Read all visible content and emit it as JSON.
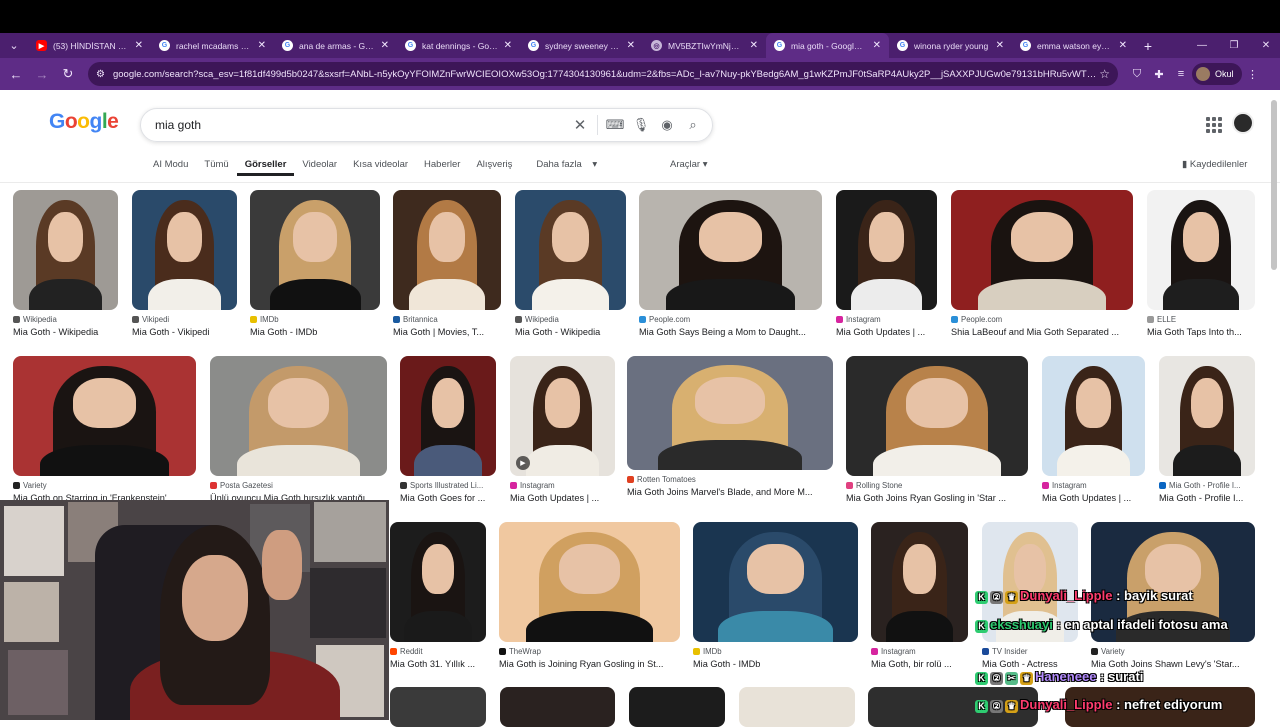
{
  "browser": {
    "tabs": [
      {
        "title": "(53) HİNDİSTAN YOL",
        "favicon": "youtube-icon",
        "active": false
      },
      {
        "title": "rachel mcadams - Go",
        "favicon": "google-icon",
        "active": false
      },
      {
        "title": "ana de armas - Goog",
        "favicon": "google-icon",
        "active": false
      },
      {
        "title": "kat dennings - Goog",
        "favicon": "google-icon",
        "active": false
      },
      {
        "title": "sydney sweeney - Go",
        "favicon": "google-icon",
        "active": false
      },
      {
        "title": "MV5BZTIwYmNjMjc",
        "favicon": "globe-icon",
        "active": false
      },
      {
        "title": "mia goth - Google'da",
        "favicon": "google-icon",
        "active": true
      },
      {
        "title": "winona ryder young",
        "favicon": "google-icon",
        "active": false
      },
      {
        "title": "emma watson eyes -",
        "favicon": "google-icon",
        "active": false
      }
    ],
    "url": "google.com/search?sca_esv=1f81df499d5b0247&sxsrf=ANbL-n5ykOyYFOIMZnFwrWCIEOIOXw53Og:1774304130961&udm=2&fbs=ADc_l-av7Nuy-pkYBedg6AM_g1wKZPmJF0tSaRP4AUky2P__jSAXXPJUGw0e79131bHRu5vWTbF2aoFlcU...",
    "profile_label": "Okul"
  },
  "google": {
    "logo": "Google",
    "query": "mia goth",
    "filters": [
      "AI Modu",
      "Tümü",
      "Görseller",
      "Videolar",
      "Kısa videolar",
      "Haberler",
      "Alışveriş",
      "Daha fazla"
    ],
    "active_filter": "Görseller",
    "tools_label": "Araçlar",
    "saved_label": "Kaydedilenler"
  },
  "results": [
    {
      "source": "Wikipedia",
      "title": "Mia Goth - Wikipedia"
    },
    {
      "source": "Vikipedi",
      "title": "Mia Goth - Vikipedi"
    },
    {
      "source": "IMDb",
      "title": "Mia Goth - IMDb"
    },
    {
      "source": "Britannica",
      "title": "Mia Goth | Movies, T..."
    },
    {
      "source": "Wikipedia",
      "title": "Mia Goth - Wikipedia"
    },
    {
      "source": "People.com",
      "title": "Mia Goth Says Being a Mom to Daught..."
    },
    {
      "source": "Instagram",
      "title": "Mia Goth Updates | ..."
    },
    {
      "source": "People.com",
      "title": "Shia LaBeouf and Mia Goth Separated ..."
    },
    {
      "source": "ELLE",
      "title": "Mia Goth Taps Into th..."
    },
    {
      "source": "Variety",
      "title": "Mia Goth on Starring in 'Frankenstein'"
    },
    {
      "source": "Posta Gazetesi",
      "title": "Ünlü oyuncu Mia Goth hırsızlık yaptığı..."
    },
    {
      "source": "Sports Illustrated Li...",
      "title": "Mia Goth Goes for ..."
    },
    {
      "source": "Instagram",
      "title": "Mia Goth Updates | ..."
    },
    {
      "source": "Rotten Tomatoes",
      "title": "Mia Goth Joins Marvel's Blade, and More M..."
    },
    {
      "source": "Rolling Stone",
      "title": "Mia Goth Joins Ryan Gosling in 'Star ..."
    },
    {
      "source": "Instagram",
      "title": "Mia Goth Updates | ..."
    },
    {
      "source": "Mia Goth - Profile I...",
      "title": "Mia Goth - Profile I..."
    },
    {
      "source": "Reddit",
      "title": "Mia Goth 31. Yıllık ..."
    },
    {
      "source": "TheWrap",
      "title": "Mia Goth is Joining Ryan Gosling in St..."
    },
    {
      "source": "IMDb",
      "title": "Mia Goth - IMDb"
    },
    {
      "source": "Instagram",
      "title": "Mia Goth, bir rolü ..."
    },
    {
      "source": "TV Insider",
      "title": "Mia Goth - Actress"
    },
    {
      "source": "Variety",
      "title": "Mia Goth Joins Shawn Levy's 'Star..."
    }
  ],
  "chat": [
    {
      "user": "Dunyali_Lipple",
      "message": ": bayik surat"
    },
    {
      "user": "eksshuayi",
      "message": ": en aptal ifadeli fotosu ama"
    },
    {
      "user": "Haneneee",
      "message": ": surati"
    },
    {
      "user": "Dunyali_Lipple",
      "message": ": nefret ediyorum"
    }
  ],
  "colors": {
    "tabstrip": "#4b1f6e",
    "active_tab": "#5e2c86",
    "chat_user": "#ff3c6e"
  }
}
